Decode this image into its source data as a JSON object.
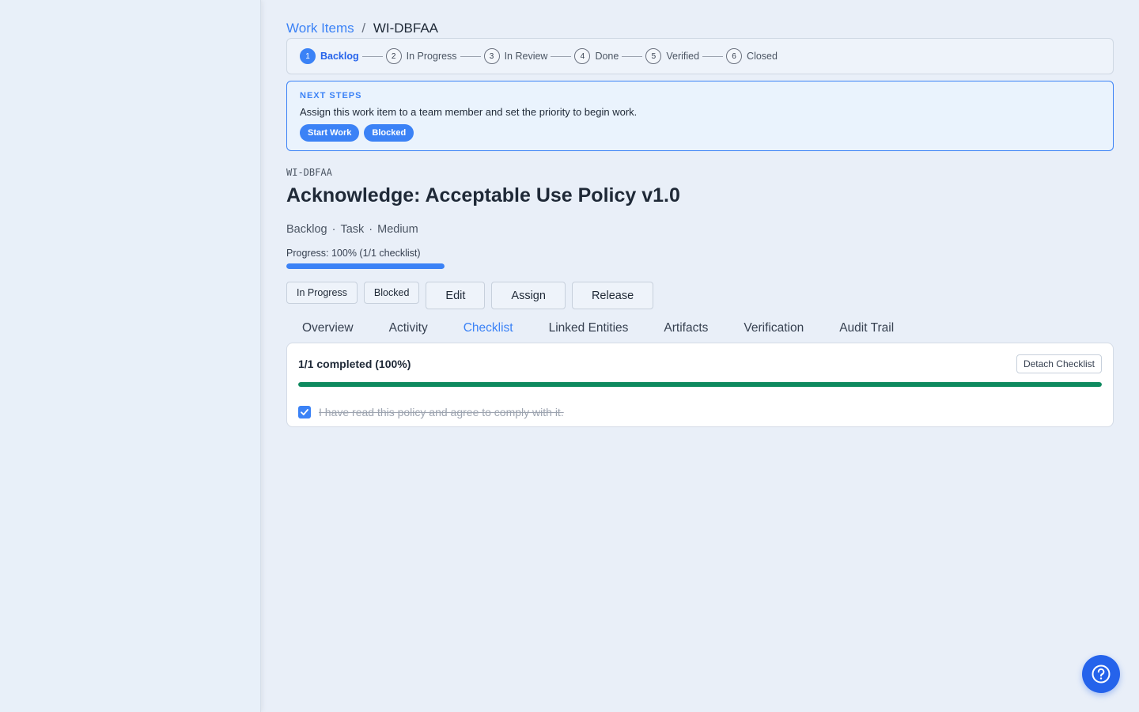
{
  "breadcrumb": {
    "parent": "Work Items",
    "separator": "/",
    "current": "WI-DBFAA"
  },
  "workflow": {
    "steps": [
      {
        "number": "1",
        "label": "Backlog",
        "active": true
      },
      {
        "number": "2",
        "label": "In Progress",
        "active": false
      },
      {
        "number": "3",
        "label": "In Review",
        "active": false
      },
      {
        "number": "4",
        "label": "Done",
        "active": false
      },
      {
        "number": "5",
        "label": "Verified",
        "active": false
      },
      {
        "number": "6",
        "label": "Closed",
        "active": false
      }
    ]
  },
  "next_steps": {
    "title": "NEXT STEPS",
    "description": "Assign this work item to a team member and set the priority to begin work.",
    "start_label": "Start Work",
    "blocked_label": "Blocked"
  },
  "item": {
    "id": "WI-DBFAA",
    "title": "Acknowledge: Acceptable Use Policy v1.0",
    "status": "Backlog",
    "type": "Task",
    "priority": "Medium",
    "meta_separator": "·",
    "progress_label": "Progress: 100% (1/1 checklist)",
    "progress_fraction": 1.0
  },
  "actions": {
    "in_progress_label": "In Progress",
    "blocked_label": "Blocked",
    "edit_label": "Edit",
    "assign_label": "Assign",
    "release_label": "Release"
  },
  "tabs": [
    {
      "label": "Overview",
      "active": false
    },
    {
      "label": "Activity",
      "active": false
    },
    {
      "label": "Checklist",
      "active": true
    },
    {
      "label": "Linked Entities",
      "active": false
    },
    {
      "label": "Artifacts",
      "active": false
    },
    {
      "label": "Verification",
      "active": false
    },
    {
      "label": "Audit Trail",
      "active": false
    }
  ],
  "checklist": {
    "summary": "1/1 completed (100%)",
    "completion_fraction": 1.0,
    "detach_label": "Detach Checklist",
    "items": [
      {
        "text": "I have read this policy and agree to comply with it.",
        "checked": true
      }
    ]
  },
  "colors": {
    "accent": "#3b82f6",
    "checklist_progress": "#0e8a5f",
    "help_button": "#2563eb"
  },
  "icons": {
    "help": "question-circle-icon",
    "check": "checkmark-icon"
  }
}
